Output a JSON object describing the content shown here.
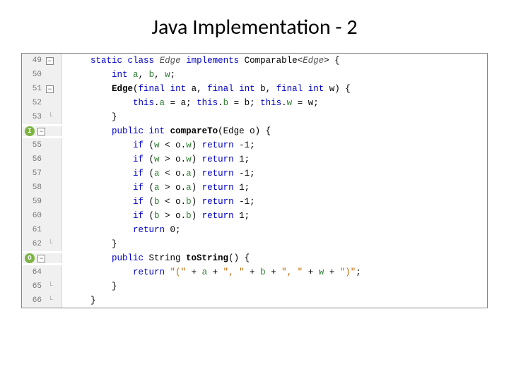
{
  "title": "Java Implementation - 2",
  "lines": [
    {
      "num": "49",
      "fold": true,
      "badge": null,
      "end": false,
      "tokens": [
        [
          0,
          "    "
        ],
        [
          "kw",
          "static"
        ],
        [
          0,
          " "
        ],
        [
          "kw",
          "class"
        ],
        [
          0,
          " "
        ],
        [
          "cls",
          "Edge"
        ],
        [
          0,
          " "
        ],
        [
          "kw",
          "implements"
        ],
        [
          0,
          " Comparable<"
        ],
        [
          "cls",
          "Edge"
        ],
        [
          0,
          "> {"
        ]
      ]
    },
    {
      "num": "50",
      "fold": false,
      "badge": null,
      "end": false,
      "tokens": [
        [
          0,
          "        "
        ],
        [
          "kw",
          "int"
        ],
        [
          0,
          " "
        ],
        [
          "var",
          "a"
        ],
        [
          0,
          ", "
        ],
        [
          "var",
          "b"
        ],
        [
          0,
          ", "
        ],
        [
          "var",
          "w"
        ],
        [
          0,
          ";"
        ]
      ]
    },
    {
      "num": "51",
      "fold": true,
      "badge": null,
      "end": false,
      "tokens": [
        [
          0,
          "        "
        ],
        [
          "method",
          "Edge"
        ],
        [
          0,
          "("
        ],
        [
          "kw",
          "final"
        ],
        [
          0,
          " "
        ],
        [
          "kw",
          "int"
        ],
        [
          0,
          " a, "
        ],
        [
          "kw",
          "final"
        ],
        [
          0,
          " "
        ],
        [
          "kw",
          "int"
        ],
        [
          0,
          " b, "
        ],
        [
          "kw",
          "final"
        ],
        [
          0,
          " "
        ],
        [
          "kw",
          "int"
        ],
        [
          0,
          " w) {"
        ]
      ]
    },
    {
      "num": "52",
      "fold": false,
      "badge": null,
      "end": false,
      "tokens": [
        [
          0,
          "            "
        ],
        [
          "kw",
          "this"
        ],
        [
          0,
          "."
        ],
        [
          "var",
          "a"
        ],
        [
          0,
          " = a; "
        ],
        [
          "kw",
          "this"
        ],
        [
          0,
          "."
        ],
        [
          "var",
          "b"
        ],
        [
          0,
          " = b; "
        ],
        [
          "kw",
          "this"
        ],
        [
          0,
          "."
        ],
        [
          "var",
          "w"
        ],
        [
          0,
          " = w;"
        ]
      ]
    },
    {
      "num": "53",
      "fold": false,
      "badge": null,
      "end": true,
      "tokens": [
        [
          0,
          "        }"
        ]
      ]
    },
    {
      "num": "",
      "fold": true,
      "badge": "I",
      "end": false,
      "tokens": [
        [
          0,
          "        "
        ],
        [
          "kw",
          "public"
        ],
        [
          0,
          " "
        ],
        [
          "kw",
          "int"
        ],
        [
          0,
          " "
        ],
        [
          "method",
          "compareTo"
        ],
        [
          0,
          "(Edge o) {"
        ]
      ]
    },
    {
      "num": "55",
      "fold": false,
      "badge": null,
      "end": false,
      "tokens": [
        [
          0,
          "            "
        ],
        [
          "kw",
          "if"
        ],
        [
          0,
          " ("
        ],
        [
          "var",
          "w"
        ],
        [
          0,
          " < o."
        ],
        [
          "var",
          "w"
        ],
        [
          0,
          ") "
        ],
        [
          "kw",
          "return"
        ],
        [
          0,
          " -1;"
        ]
      ]
    },
    {
      "num": "56",
      "fold": false,
      "badge": null,
      "end": false,
      "tokens": [
        [
          0,
          "            "
        ],
        [
          "kw",
          "if"
        ],
        [
          0,
          " ("
        ],
        [
          "var",
          "w"
        ],
        [
          0,
          " > o."
        ],
        [
          "var",
          "w"
        ],
        [
          0,
          ") "
        ],
        [
          "kw",
          "return"
        ],
        [
          0,
          " 1;"
        ]
      ]
    },
    {
      "num": "57",
      "fold": false,
      "badge": null,
      "end": false,
      "tokens": [
        [
          0,
          "            "
        ],
        [
          "kw",
          "if"
        ],
        [
          0,
          " ("
        ],
        [
          "var",
          "a"
        ],
        [
          0,
          " < o."
        ],
        [
          "var",
          "a"
        ],
        [
          0,
          ") "
        ],
        [
          "kw",
          "return"
        ],
        [
          0,
          " -1;"
        ]
      ]
    },
    {
      "num": "58",
      "fold": false,
      "badge": null,
      "end": false,
      "tokens": [
        [
          0,
          "            "
        ],
        [
          "kw",
          "if"
        ],
        [
          0,
          " ("
        ],
        [
          "var",
          "a"
        ],
        [
          0,
          " > o."
        ],
        [
          "var",
          "a"
        ],
        [
          0,
          ") "
        ],
        [
          "kw",
          "return"
        ],
        [
          0,
          " 1;"
        ]
      ]
    },
    {
      "num": "59",
      "fold": false,
      "badge": null,
      "end": false,
      "tokens": [
        [
          0,
          "            "
        ],
        [
          "kw",
          "if"
        ],
        [
          0,
          " ("
        ],
        [
          "var",
          "b"
        ],
        [
          0,
          " < o."
        ],
        [
          "var",
          "b"
        ],
        [
          0,
          ") "
        ],
        [
          "kw",
          "return"
        ],
        [
          0,
          " -1;"
        ]
      ]
    },
    {
      "num": "60",
      "fold": false,
      "badge": null,
      "end": false,
      "tokens": [
        [
          0,
          "            "
        ],
        [
          "kw",
          "if"
        ],
        [
          0,
          " ("
        ],
        [
          "var",
          "b"
        ],
        [
          0,
          " > o."
        ],
        [
          "var",
          "b"
        ],
        [
          0,
          ") "
        ],
        [
          "kw",
          "return"
        ],
        [
          0,
          " 1;"
        ]
      ]
    },
    {
      "num": "61",
      "fold": false,
      "badge": null,
      "end": false,
      "tokens": [
        [
          0,
          "            "
        ],
        [
          "kw",
          "return"
        ],
        [
          0,
          " 0;"
        ]
      ]
    },
    {
      "num": "62",
      "fold": false,
      "badge": null,
      "end": true,
      "tokens": [
        [
          0,
          "        }"
        ]
      ]
    },
    {
      "num": "",
      "fold": true,
      "badge": "O",
      "end": false,
      "tokens": [
        [
          0,
          "        "
        ],
        [
          "kw",
          "public"
        ],
        [
          0,
          " String "
        ],
        [
          "method",
          "toString"
        ],
        [
          0,
          "() {"
        ]
      ]
    },
    {
      "num": "64",
      "fold": false,
      "badge": null,
      "end": false,
      "tokens": [
        [
          0,
          "            "
        ],
        [
          "kw",
          "return"
        ],
        [
          0,
          " "
        ],
        [
          "str",
          "\"(\""
        ],
        [
          0,
          " + "
        ],
        [
          "var",
          "a"
        ],
        [
          0,
          " + "
        ],
        [
          "str",
          "\", \""
        ],
        [
          0,
          " + "
        ],
        [
          "var",
          "b"
        ],
        [
          0,
          " + "
        ],
        [
          "str",
          "\", \""
        ],
        [
          0,
          " + "
        ],
        [
          "var",
          "w"
        ],
        [
          0,
          " + "
        ],
        [
          "str",
          "\")\""
        ],
        [
          0,
          ";"
        ]
      ]
    },
    {
      "num": "65",
      "fold": false,
      "badge": null,
      "end": true,
      "tokens": [
        [
          0,
          "        }"
        ]
      ]
    },
    {
      "num": "66",
      "fold": false,
      "badge": null,
      "end": true,
      "tokens": [
        [
          0,
          "    }"
        ]
      ]
    }
  ]
}
